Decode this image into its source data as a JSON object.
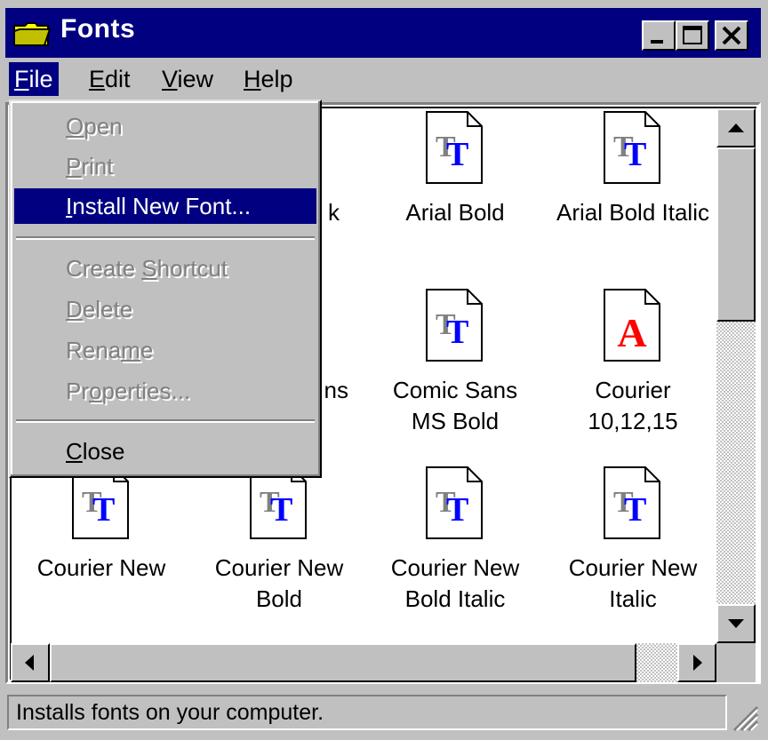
{
  "window": {
    "title": "Fonts"
  },
  "menubar": {
    "items": [
      {
        "label": "File",
        "mnemonic": "F",
        "rest": "ile"
      },
      {
        "label": "Edit",
        "mnemonic": "E",
        "rest": "dit"
      },
      {
        "label": "View",
        "mnemonic": "V",
        "rest": "iew"
      },
      {
        "label": "Help",
        "mnemonic": "H",
        "rest": "elp"
      }
    ]
  },
  "file_menu": {
    "items": [
      {
        "pre": "",
        "mn": "O",
        "post": "pen",
        "state": "disabled"
      },
      {
        "pre": "",
        "mn": "P",
        "post": "rint",
        "state": "disabled"
      },
      {
        "pre": "",
        "mn": "I",
        "post": "nstall New Font...",
        "state": "selected"
      },
      {
        "pre": "Create ",
        "mn": "S",
        "post": "hortcut",
        "state": "disabled"
      },
      {
        "pre": "",
        "mn": "D",
        "post": "elete",
        "state": "disabled"
      },
      {
        "pre": "Rena",
        "mn": "m",
        "post": "e",
        "state": "disabled"
      },
      {
        "pre": "Pr",
        "mn": "o",
        "post": "perties...",
        "state": "disabled"
      },
      {
        "pre": "",
        "mn": "C",
        "post": "lose",
        "state": "enabled"
      }
    ]
  },
  "fonts": {
    "row1": [
      {
        "line1": "k",
        "line2": ""
      },
      {
        "line1": "Arial Bold",
        "line2": ""
      },
      {
        "line1": "Arial Bold Italic",
        "line2": ""
      }
    ],
    "row2": [
      {
        "line1": "ns",
        "line2": ""
      },
      {
        "line1": "Comic Sans",
        "line2": "MS Bold"
      },
      {
        "line1": "Courier",
        "line2": "10,12,15"
      }
    ],
    "row3": [
      {
        "line1": "Courier New",
        "line2": ""
      },
      {
        "line1": "Courier New",
        "line2": "Bold"
      },
      {
        "line1": "Courier New",
        "line2": "Bold Italic"
      },
      {
        "line1": "Courier New",
        "line2": "Italic"
      }
    ],
    "icon_types": {
      "truetype": "TT",
      "raster": "A"
    }
  },
  "statusbar": {
    "text": "Installs fonts on your computer."
  },
  "colors": {
    "titlebar": "#000080",
    "selection": "#000080",
    "face": "#c0c0c0",
    "tt_blue": "#0000ff",
    "raster_red": "#ff0000"
  }
}
